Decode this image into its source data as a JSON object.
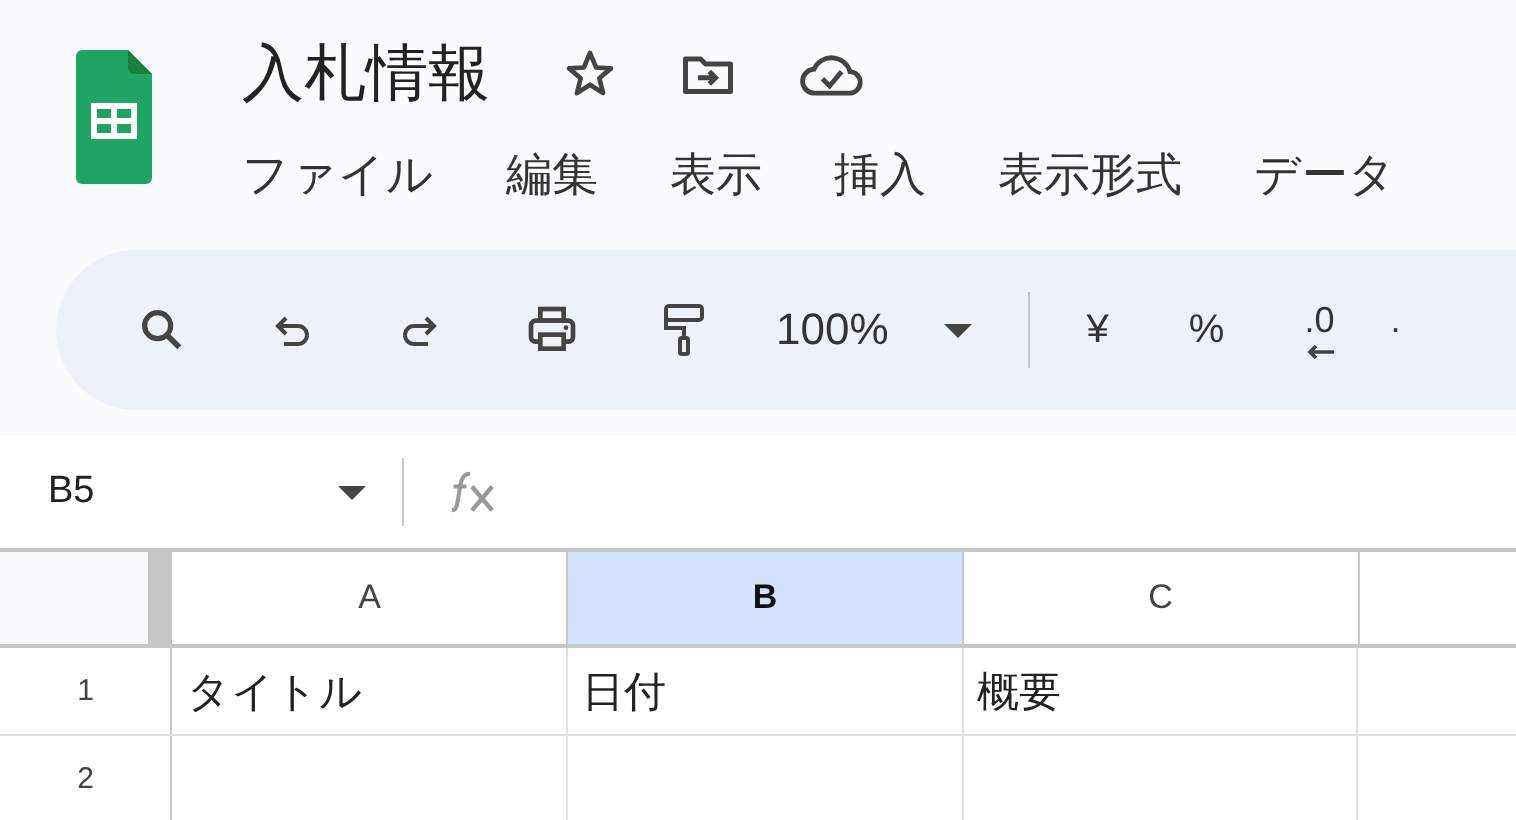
{
  "document": {
    "title": "入札情報"
  },
  "menu": [
    "ファイル",
    "編集",
    "表示",
    "挿入",
    "表示形式",
    "データ"
  ],
  "toolbar": {
    "zoom": "100%",
    "items": [
      {
        "kind": "currency",
        "label": "¥"
      },
      {
        "kind": "percent",
        "label": "%"
      },
      {
        "kind": "decimal_less",
        "label": ".0"
      },
      {
        "kind": "decimal_more",
        "label": "."
      }
    ]
  },
  "formula_bar": {
    "cell_ref": "B5"
  },
  "grid": {
    "columns": [
      {
        "label": "A",
        "selected": false
      },
      {
        "label": "B",
        "selected": true
      },
      {
        "label": "C",
        "selected": false
      }
    ],
    "rows": [
      {
        "number": "1",
        "cells": [
          "タイトル",
          "日付",
          "概要"
        ]
      },
      {
        "number": "2"
      }
    ]
  }
}
